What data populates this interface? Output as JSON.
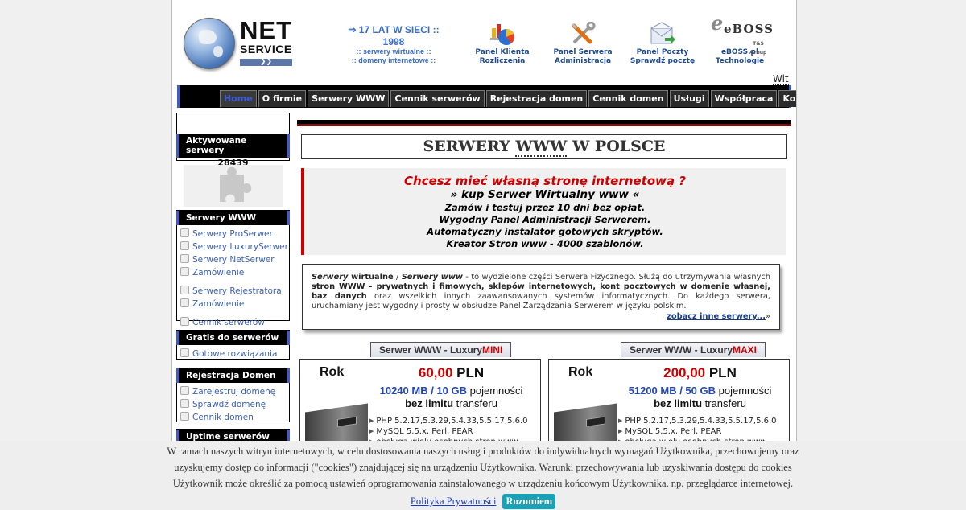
{
  "header": {
    "logo": {
      "line1": "NET",
      "line2": "SERVICE",
      "arrows": "❯❯"
    },
    "slogan": {
      "line1": "⇒ 17 LAT W SIECI ::",
      "line2": "1998",
      "line3": ":: serwery wirtualne ::",
      "line4": ":: domeny internetowe ::"
    },
    "panels": [
      {
        "icon": "chart-icon",
        "line1": "Panel Klienta",
        "line2": "Rozliczenia"
      },
      {
        "icon": "tools-icon",
        "line1": "Panel Serwera",
        "line2": "Administracja"
      },
      {
        "icon": "mail-icon",
        "line1": "Panel Poczty",
        "line2": "Sprawdź pocztę"
      },
      {
        "icon": "eboss-logo",
        "line1": "eBOSS.pl",
        "line2": "Technologie",
        "logo_text": "eBOSS",
        "logo_sub": "T&S Group"
      }
    ],
    "welcome": "Wit"
  },
  "nav": {
    "items": [
      "Home",
      "O firmie",
      "Serwery WWW",
      "Cennik serwerów",
      "Rejestracja domen",
      "Cennik domen",
      "Usługi",
      "Współpraca",
      "Kontakt"
    ],
    "active": "Home"
  },
  "sidebar": {
    "active_servers": {
      "label": "Aktywowane serwery",
      "count": "28439"
    },
    "sections": [
      {
        "title": "Serwery WWW",
        "items": [
          "Serwery ProSerwer",
          "Serwery LuxurySerwer",
          "Serwery NetSerwer",
          "Zamówienie",
          "Serwery Rejestratora",
          "Zamówienie",
          "Cennik serwerów"
        ]
      },
      {
        "title": "Gratis do serwerów",
        "items": [
          "Gotowe rozwiązania"
        ]
      },
      {
        "title": "Rejestracja Domen",
        "items": [
          "Zarejestruj domenę",
          "Sprawdź domenę",
          "Cennik domen"
        ]
      },
      {
        "title": "Uptime serwerów",
        "items": []
      }
    ]
  },
  "main": {
    "title_pre": "SERWERY ",
    "title_www": "WWW",
    "title_post": " W POLSCE",
    "promo": {
      "headline": "Chcesz mieć własną stronę internetową ?",
      "sub": "» kup Serwer Wirtualny www «",
      "lines": [
        "Zamów i testuj przez 10 dni bez opłat.",
        "Wygodny Panel Administracji Serwerem.",
        "Automatyczny instalator gotowych skryptów.",
        "Kreator Stron www - 4000 szablonów."
      ]
    },
    "description": {
      "t1": "Serwery",
      "t2": " wirtualne",
      "t3": " / ",
      "t4": "Serwery www",
      "t5": " - to wydzielone części Serwera Fizycznego. Służą do utrzymywania własnych ",
      "t6": "stron WWW - prywatnych i fimowych, sklepów internetowych, kont pocztowych w domenie własnej, baz danych",
      "t7": " oraz wszelkich innych zaawansowanych systemów informatycznych. Do każdego serwera, uruchamiany jest wygodny i prosty w obsłudze Panel Zarządzania Serwerem w języku polskim.",
      "more_link": "zobacz inne serwery...",
      "more_suffix": "»"
    },
    "offers": [
      {
        "tab_prefix": "Serwer WWW - Luxury",
        "tab_highlight": "MINI",
        "period": "Rok",
        "price": "60,00",
        "currency": " PLN",
        "capacity": "10240 MB / 10 GB",
        "capacity_suffix": " pojemności",
        "transfer_bold": "bez limitu",
        "transfer_suffix": " transferu",
        "features": [
          "PHP 5.2.17,5.3.29,5.4.33,5.5.17,5.6.0",
          "MySQL 5.5.x, Perl, PEAR",
          "obsługa wielu osobnych stron www"
        ]
      },
      {
        "tab_prefix": "Serwer WWW - Luxury",
        "tab_highlight": "MAXI",
        "period": "Rok",
        "price": "200,00",
        "currency": " PLN",
        "capacity": "51200 MB / 50 GB",
        "capacity_suffix": " pojemności",
        "transfer_bold": "bez limitu",
        "transfer_suffix": " transferu",
        "features": [
          "PHP 5.2.17,5.3.29,5.4.33,5.5.17,5.6.0",
          "MySQL 5.5.x, Perl, PEAR",
          "obsługa wielu osobnych stron www"
        ]
      }
    ]
  },
  "cookie": {
    "lines": [
      "W ramach naszych witryn internetowych, w celu dostosowania naszych usług i produktów do indywidualnych wymagań Użytkownika, przechowujemy oraz",
      "uzyskujemy dostęp do informacji (\"cookies\") znajdującej się na urządzeniu Użytkownika. Warunki przechowywania lub uzyskiwania dostępu do cookies",
      "Użytkownik może określić za pomocą ustawień oprogramowania zainstalowanego w urządzeniu końcowym Użytkownika, np. przeglądarce internetowej."
    ],
    "privacy_link": "Polityka Prywatności",
    "accept_button": "Rozumiem"
  },
  "colors": {
    "accent_blue": "#3c5ad4",
    "accent_red": "#cc0000",
    "link_blue": "#3a5fb0",
    "cookie_button": "#17a2b8"
  }
}
